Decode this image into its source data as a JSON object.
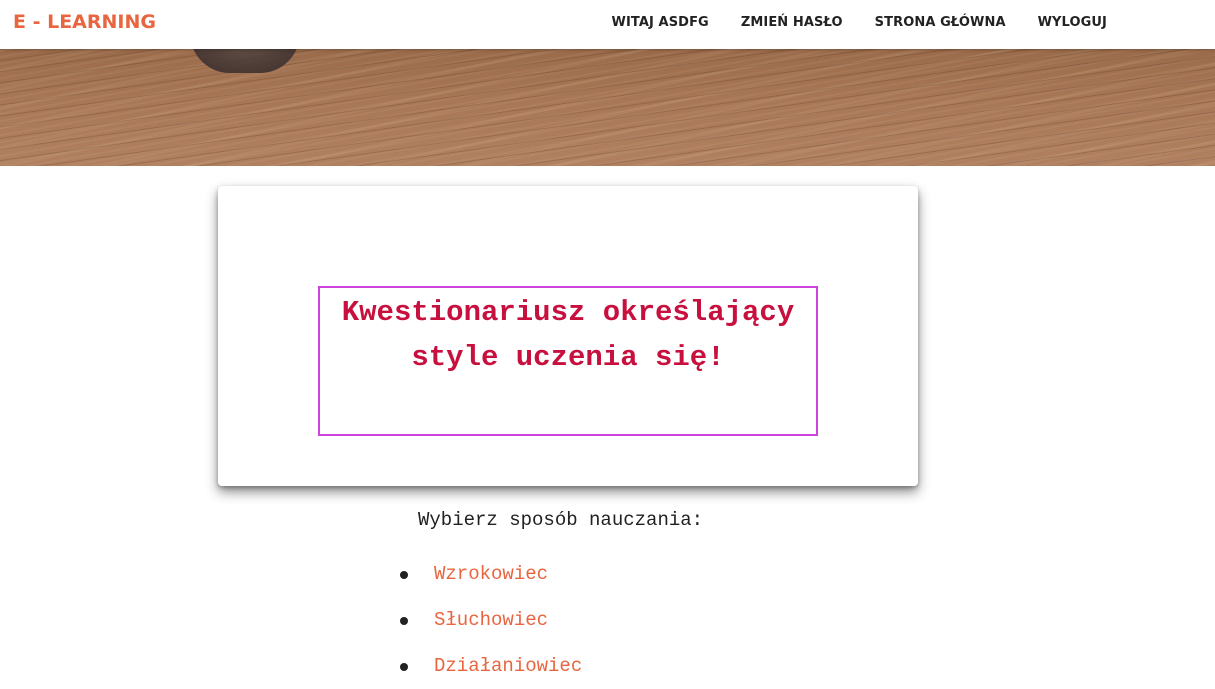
{
  "colors": {
    "brand": "#e8653f",
    "accent_link": "#e8653f",
    "title_text": "#c8103e",
    "title_border": "#cc44dd",
    "nav_text": "#222222"
  },
  "navbar": {
    "brand": "E - LEARNING",
    "links": [
      {
        "label": "WITAJ ASDFG"
      },
      {
        "label": "ZMIEŃ HASŁO"
      },
      {
        "label": "STRONA GŁÓWNA"
      },
      {
        "label": "WYLOGUJ"
      }
    ]
  },
  "card": {
    "title_line1": "Kwestionariusz określający",
    "title_line2": "style uczenia się!"
  },
  "main": {
    "question": "Wybierz sposób nauczania:",
    "options": [
      {
        "label": "Wzrokowiec"
      },
      {
        "label": "Słuchowiec"
      },
      {
        "label": "Działaniowiec"
      }
    ]
  }
}
